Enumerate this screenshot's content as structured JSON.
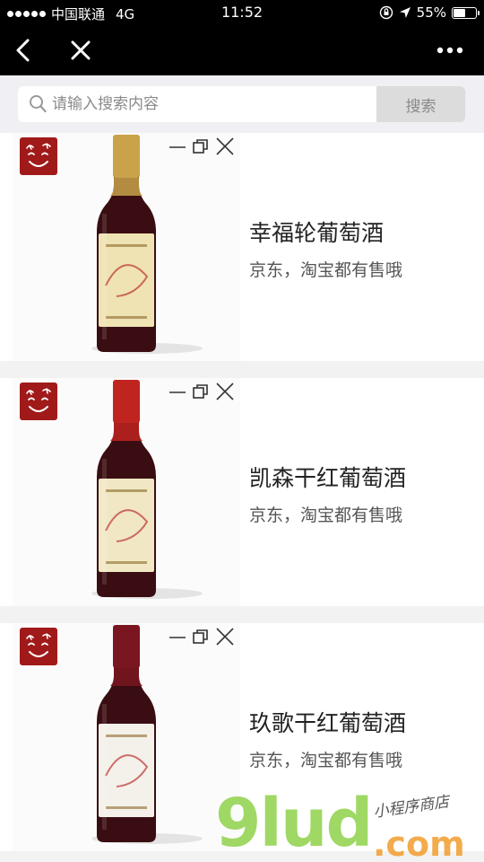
{
  "status_bar": {
    "carrier": "中国联通",
    "network": "4G",
    "time": "11:52",
    "battery": "55%",
    "battery_level": 0.55
  },
  "nav": {
    "back_icon": "chevron-left-icon",
    "close_icon": "close-icon",
    "more_icon": "more-icon"
  },
  "search": {
    "placeholder": "请输入搜索内容",
    "button_label": "搜索"
  },
  "products": [
    {
      "title": "幸福轮葡萄酒",
      "subtitle": "京东，淘宝都有售哦",
      "bottle_cap_color": "#c9a24a",
      "label_color": "#efe2b3"
    },
    {
      "title": "凯森干红葡萄酒",
      "subtitle": "京东，淘宝都有售哦",
      "bottle_cap_color": "#c0241f",
      "label_color": "#f1e7c4"
    },
    {
      "title": "玖歌干红葡萄酒",
      "subtitle": "京东，淘宝都有售哦",
      "bottle_cap_color": "#7a1620",
      "label_color": "#f4f1ea"
    }
  ],
  "watermark": {
    "brand": "9lud",
    "domain": ".com",
    "tagline": "小程序商店"
  },
  "colors": {
    "nav_bg": "#000000",
    "logo_bg": "#a11a1a",
    "wine": "#3a0d12",
    "watermark_green": "#8fd24a",
    "watermark_orange": "#f2a23a"
  }
}
